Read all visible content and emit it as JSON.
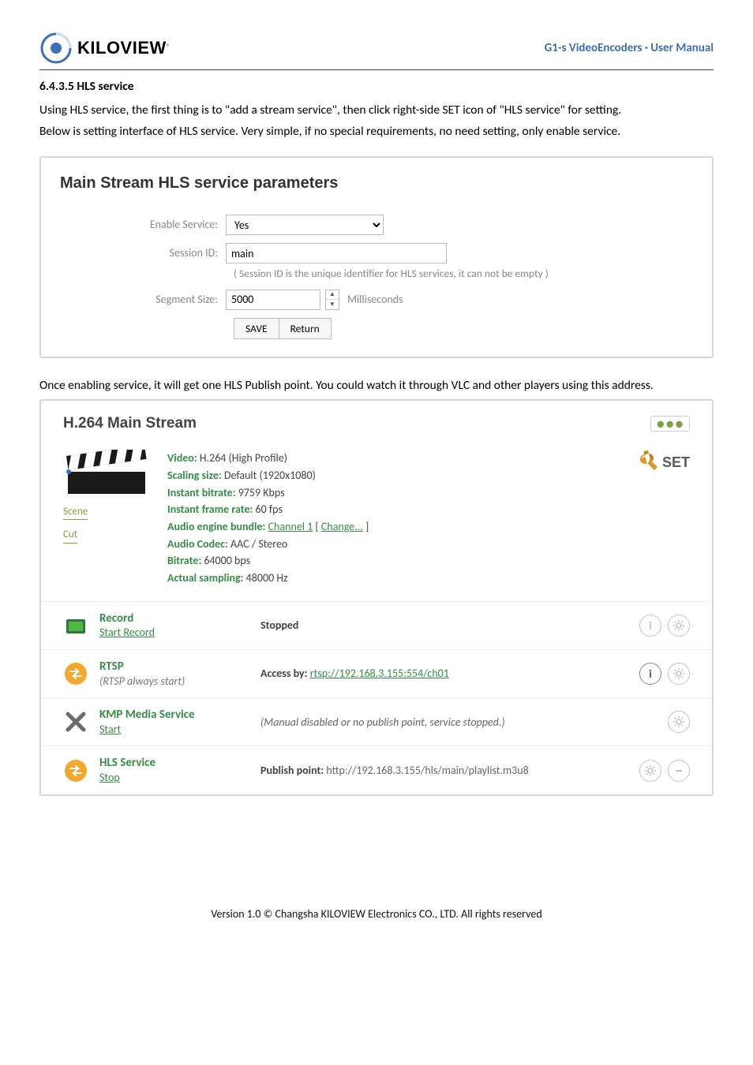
{
  "header": {
    "brand": "KILOVIEW",
    "register_mark": "®",
    "doc_title": "G1-s VideoEncoders · User Manual"
  },
  "section": {
    "heading": "6.4.3.5  HLS service"
  },
  "body": {
    "p1": "Using HLS service, the first thing is to \"add a stream service\", then click right-side SET icon of \"HLS service\" for setting.",
    "p2": "Below is setting interface of HLS service. Very simple, if no special requirements, no need setting, only enable service.",
    "p3": "Once enabling service, it will get one HLS Publish point. You could watch it through VLC and other players using this address."
  },
  "hls_panel": {
    "title": "Main Stream HLS service parameters",
    "enable_label": "Enable Service:",
    "enable_value": "Yes",
    "session_label": "Session ID:",
    "session_value": "main",
    "session_hint": "( Session ID is the unique identifier for HLS services, it can not be empty )",
    "segment_label": "Segment Size:",
    "segment_value": "5000",
    "segment_unit": "Milliseconds",
    "save_btn": "SAVE",
    "return_btn": "Return"
  },
  "stream_panel": {
    "title": "H.264 Main Stream",
    "more": "●●●",
    "scene": "Scene",
    "cut": "Cut",
    "set_text": "SET",
    "props": [
      {
        "k": "Video:",
        "v": " H.264 (High Profile)"
      },
      {
        "k": "Scaling size:",
        "v": " Default (1920x1080)"
      },
      {
        "k": "Instant bitrate:",
        "v": " 9759 Kbps"
      },
      {
        "k": "Instant frame rate:",
        "v": " 60 fps"
      },
      {
        "k": "Audio engine bundle:",
        "v_link": "Channel 1",
        "v2": " [ ",
        "v2_link": "Change...",
        "v3": " ]"
      },
      {
        "k": "Audio Codec:",
        "v": " AAC / Stereo"
      },
      {
        "k": "Bitrate:",
        "v": " 64000 bps"
      },
      {
        "k": "Actual sampling:",
        "v": " 48000 Hz"
      }
    ],
    "services": [
      {
        "icon": "record",
        "name": "Record",
        "sub_link": "Start Record",
        "mid_bold": "Stopped",
        "right": [
          "info",
          "gear"
        ]
      },
      {
        "icon": "arrows",
        "name": "RTSP",
        "sub_plain": "(RTSP always start)",
        "mid_prefix": "Access by: ",
        "mid_link": "rtsp://192.168.3.155:554/ch01",
        "right": [
          "info-dark",
          "gear"
        ]
      },
      {
        "icon": "cross",
        "name": "KMP Media Service",
        "sub_link": "Start",
        "mid_plain_italic": "(Manual disabled or no publish point, service stopped.)",
        "right": [
          "gear"
        ]
      },
      {
        "icon": "arrows",
        "name": "HLS Service",
        "sub_link": "Stop",
        "mid_prefix_bold": "Publish point: ",
        "mid_plain": "http://192.168.3.155/hls/main/playlist.m3u8",
        "right": [
          "gear",
          "minus"
        ]
      }
    ]
  },
  "footer": "Version 1.0 © Changsha KILOVIEW Electronics CO., LTD. All rights reserved"
}
